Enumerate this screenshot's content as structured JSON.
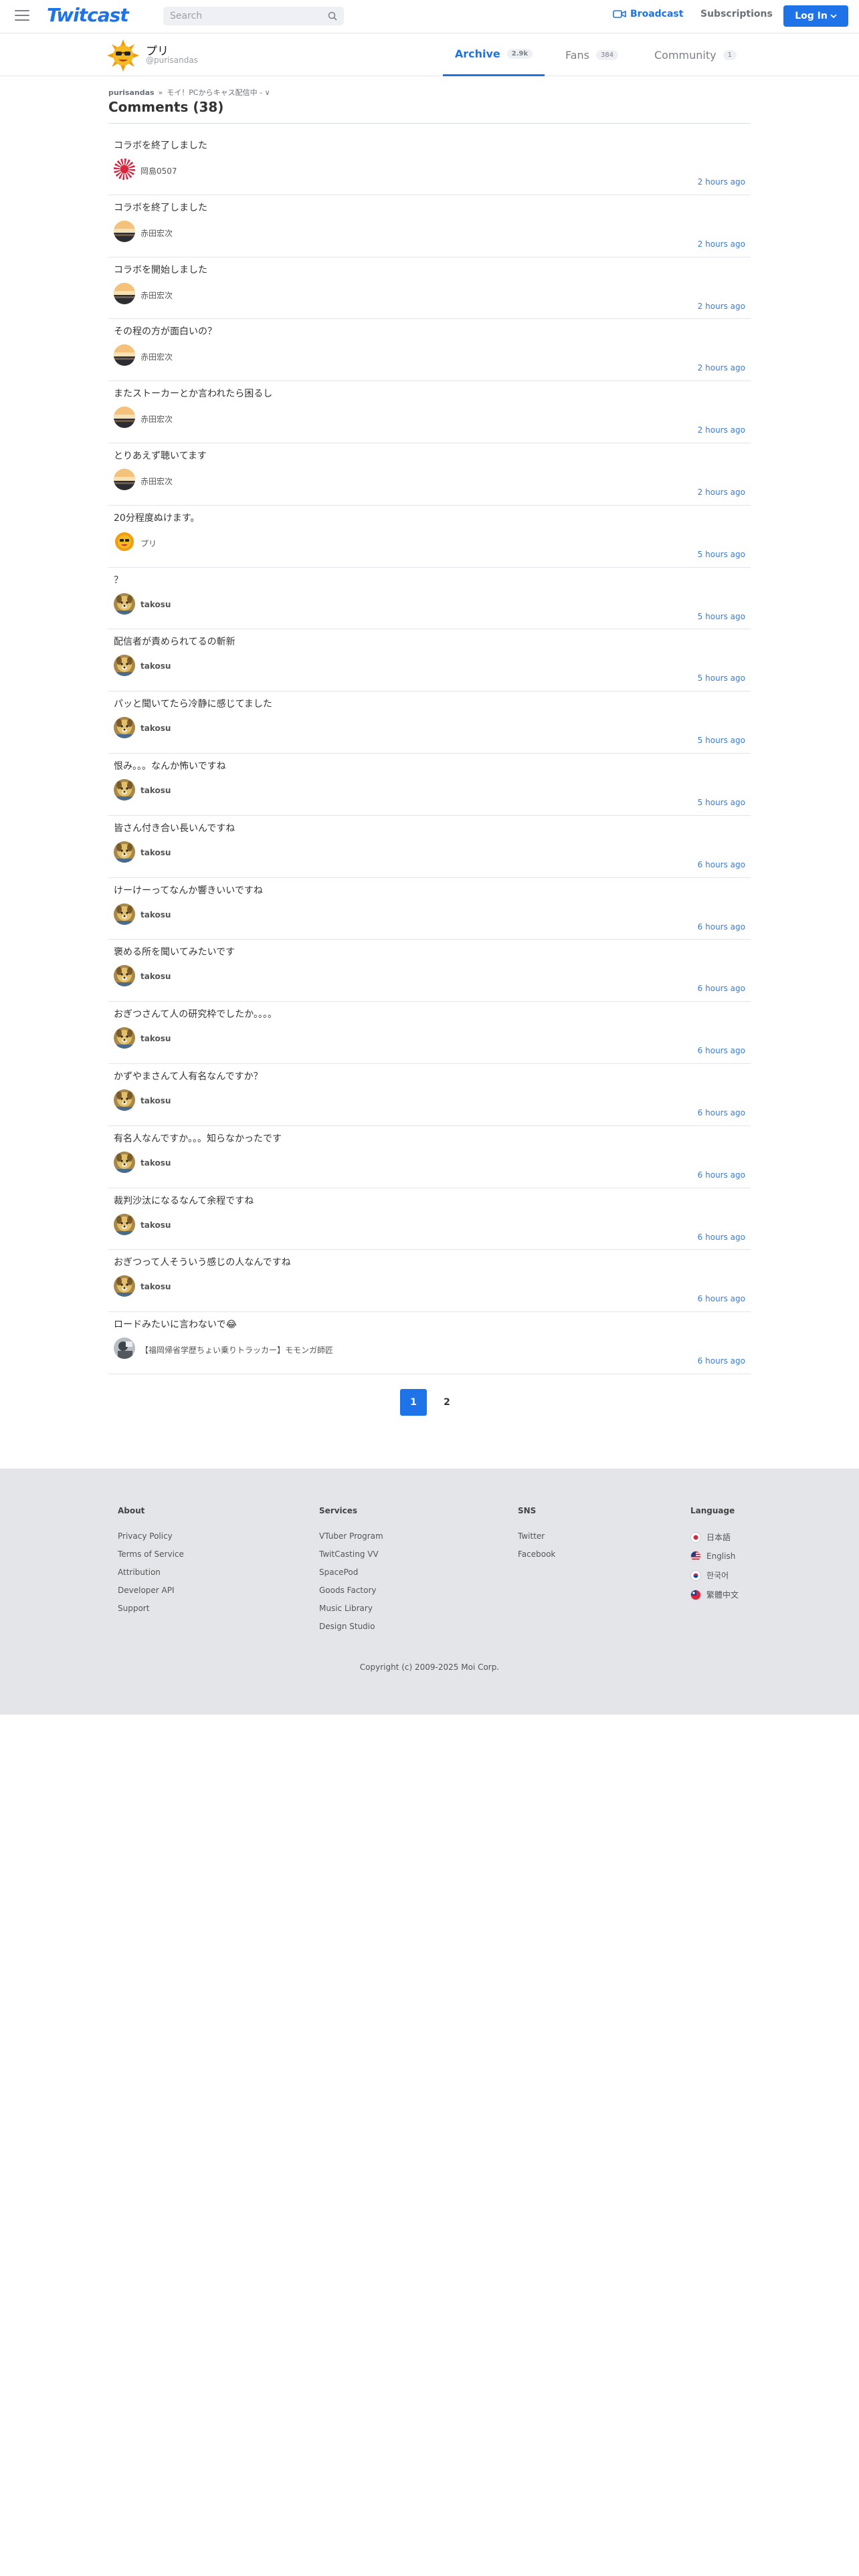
{
  "header": {
    "logo": "Twitcast",
    "search_placeholder": "Search",
    "broadcast": "Broadcast",
    "subscriptions": "Subscriptions",
    "login": "Log In"
  },
  "profile": {
    "name": "プリ",
    "handle": "@purisandas",
    "tabs": [
      {
        "label": "Archive",
        "count": "2.9k"
      },
      {
        "label": "Fans",
        "count": "384"
      },
      {
        "label": "Community",
        "count": "1"
      }
    ]
  },
  "breadcrumb": {
    "user": "purisandas",
    "separator": "»",
    "movie": "モイ！PCからキャス配信中 -",
    "chevron": "∨"
  },
  "comments_title": "Comments (38)",
  "comments": [
    {
      "text": "コラボを終了しました",
      "author": "岡島0507",
      "time": "2 hours ago",
      "avatar": "rising-sun"
    },
    {
      "text": "コラボを終了しました",
      "author": "赤田宏次",
      "time": "2 hours ago",
      "avatar": "sunset"
    },
    {
      "text": "コラボを開始しました",
      "author": "赤田宏次",
      "time": "2 hours ago",
      "avatar": "sunset"
    },
    {
      "text": "その程の方が面白いの？",
      "author": "赤田宏次",
      "time": "2 hours ago",
      "avatar": "sunset"
    },
    {
      "text": "またストーカーとか言われたら困るし",
      "author": "赤田宏次",
      "time": "2 hours ago",
      "avatar": "sunset"
    },
    {
      "text": "とりあえず聴いてます",
      "author": "赤田宏次",
      "time": "2 hours ago",
      "avatar": "sunset"
    },
    {
      "text": "20分程度ぬけます。",
      "author": "プリ",
      "time": "5 hours ago",
      "avatar": "sun-char"
    },
    {
      "text": "？",
      "author": "takosu",
      "time": "5 hours ago",
      "avatar": "dog"
    },
    {
      "text": "配信者が責められてるの斬新",
      "author": "takosu",
      "time": "5 hours ago",
      "avatar": "dog"
    },
    {
      "text": "パッと聞いてたら冷静に感じてました",
      "author": "takosu",
      "time": "5 hours ago",
      "avatar": "dog"
    },
    {
      "text": "恨み。。。なんか怖いですね",
      "author": "takosu",
      "time": "5 hours ago",
      "avatar": "dog"
    },
    {
      "text": "皆さん付き合い長いんですね",
      "author": "takosu",
      "time": "6 hours ago",
      "avatar": "dog"
    },
    {
      "text": "けーけーってなんか響きいいですね",
      "author": "takosu",
      "time": "6 hours ago",
      "avatar": "dog"
    },
    {
      "text": "褒める所を聞いてみたいです",
      "author": "takosu",
      "time": "6 hours ago",
      "avatar": "dog"
    },
    {
      "text": "おぎつさんて人の研究枠でしたか。。。。",
      "author": "takosu",
      "time": "6 hours ago",
      "avatar": "dog"
    },
    {
      "text": "かずやまさんて人有名なんですか？",
      "author": "takosu",
      "time": "6 hours ago",
      "avatar": "dog"
    },
    {
      "text": "有名人なんですか。。。知らなかったです",
      "author": "takosu",
      "time": "6 hours ago",
      "avatar": "dog"
    },
    {
      "text": "裁判沙汰になるなんて余程ですね",
      "author": "takosu",
      "time": "6 hours ago",
      "avatar": "dog"
    },
    {
      "text": "おぎつって人そういう感じの人なんですね",
      "author": "takosu",
      "time": "6 hours ago",
      "avatar": "dog"
    },
    {
      "text": "ロードみたいに言わないで😂",
      "author": "【福岡帰省学歴ちょい乗りトラッカー】モモンガ師匠",
      "time": "6 hours ago",
      "avatar": "photo"
    }
  ],
  "pagination": [
    "1",
    "2"
  ],
  "footer": {
    "about": {
      "title": "About",
      "links": [
        "Privacy Policy",
        "Terms of Service",
        "Attribution",
        "Developer API",
        "Support"
      ]
    },
    "services": {
      "title": "Services",
      "links": [
        "VTuber Program",
        "TwitCasting VV",
        "SpacePod",
        "Goods Factory",
        "Music Library",
        "Design Studio"
      ]
    },
    "sns": {
      "title": "SNS",
      "links": [
        "Twitter",
        "Facebook"
      ]
    },
    "language": {
      "title": "Language",
      "links": [
        "日本語",
        "English",
        "한국어",
        "繁體中文"
      ]
    },
    "copyright": "Copyright (c) 2009-2025 Moi Corp."
  },
  "colors": {
    "accent": "#1e73e8",
    "time": "#3a7bd5",
    "footer_bg": "#e3e5e8"
  }
}
